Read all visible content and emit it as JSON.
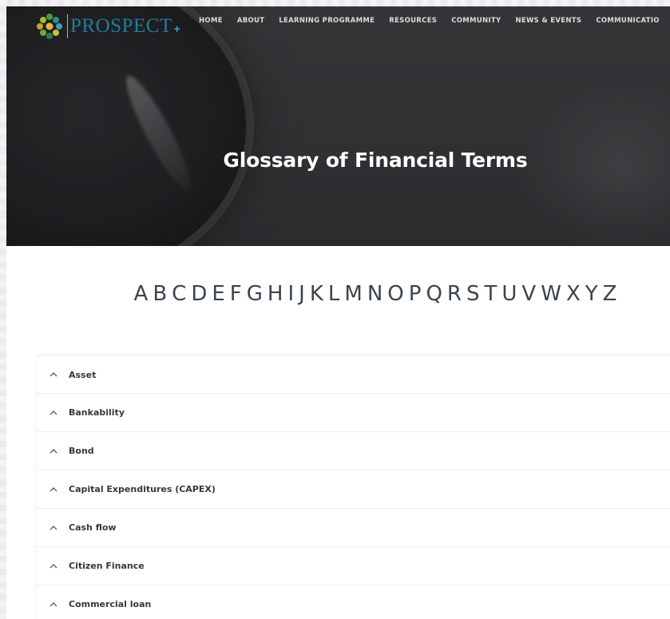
{
  "site": {
    "logo_text": "PROSPECT",
    "logo_plus": "+"
  },
  "nav": {
    "items": [
      {
        "label": "HOME"
      },
      {
        "label": "ABOUT"
      },
      {
        "label": "LEARNING PROGRAMME"
      },
      {
        "label": "RESOURCES"
      },
      {
        "label": "COMMUNITY"
      },
      {
        "label": "NEWS & EVENTS"
      },
      {
        "label": "COMMUNICATIO"
      }
    ]
  },
  "hero": {
    "title": "Glossary of Financial Terms"
  },
  "alphabet": [
    "A",
    "B",
    "C",
    "D",
    "E",
    "F",
    "G",
    "H",
    "I",
    "J",
    "K",
    "L",
    "M",
    "N",
    "O",
    "P",
    "Q",
    "R",
    "S",
    "T",
    "U",
    "V",
    "W",
    "X",
    "Y",
    "Z"
  ],
  "glossary": {
    "items": [
      {
        "label": "Asset"
      },
      {
        "label": "Bankability"
      },
      {
        "label": "Bond"
      },
      {
        "label": "Capital Expenditures (CAPEX)"
      },
      {
        "label": "Cash flow"
      },
      {
        "label": "Citizen Finance"
      },
      {
        "label": "Commercial loan"
      }
    ]
  },
  "colors": {
    "logo_blue": "#1f7c9a",
    "hero_dark": "#363638",
    "alphabet": "#3a4450",
    "item_text": "#33393f"
  }
}
